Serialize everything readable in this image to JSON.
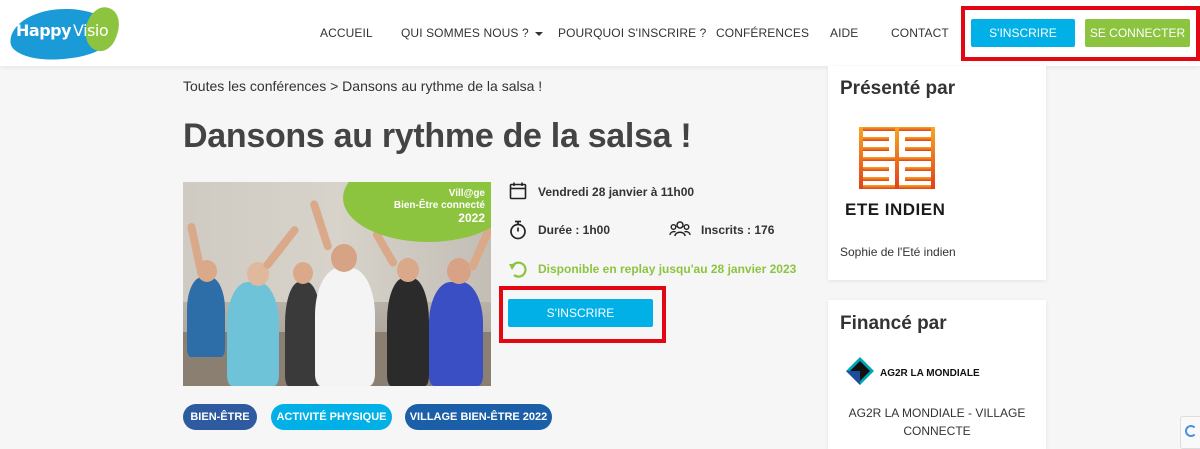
{
  "brand": {
    "name_part1": "Happy",
    "name_part2": "Visio",
    "colors": {
      "blue": "#1a9ad7",
      "green": "#8cc43f",
      "cyan": "#00b0e6",
      "red": "#e30613"
    }
  },
  "nav": {
    "items": [
      {
        "label": "ACCUEIL"
      },
      {
        "label": "QUI SOMMES NOUS ?",
        "has_dropdown": true
      },
      {
        "label": "POURQUOI S'INSCRIRE ?"
      },
      {
        "label": "CONFÉRENCES"
      },
      {
        "label": "AIDE"
      },
      {
        "label": "CONTACT"
      }
    ],
    "signup_label": "S'INSCRIRE",
    "login_label": "SE CONNECTER"
  },
  "breadcrumb": {
    "parent": "Toutes les conférences",
    "separator": ">",
    "current": "Dansons au rythme de la salsa !"
  },
  "event": {
    "title": "Dansons au rythme de la salsa !",
    "image_badge": {
      "line1": "Vill@ge",
      "line2": "Bien-Être connecté",
      "line3": "2022"
    },
    "date": "Vendredi 28 janvier à 11h00",
    "duration": "Durée : 1h00",
    "registered": "Inscrits : 176",
    "replay": "Disponible en replay jusqu'au 28 janvier 2023",
    "signup_label": "S'INSCRIRE",
    "icons": [
      "calendar-icon",
      "stopwatch-icon",
      "people-icon",
      "replay-icon"
    ],
    "tags": [
      "BIEN-ÊTRE",
      "ACTIVITÉ PHYSIQUE",
      "VILLAGE BIEN-ÊTRE 2022"
    ]
  },
  "sidebar": {
    "presented": {
      "title": "Présenté par",
      "org_logo_text": "ETE INDIEN",
      "presenter": "Sophie de l'Eté indien"
    },
    "financed": {
      "title": "Financé par",
      "org_logo_text": "AG2R LA MONDIALE",
      "org_name": "AG2R LA MONDIALE - VILLAGE CONNECTE"
    }
  }
}
